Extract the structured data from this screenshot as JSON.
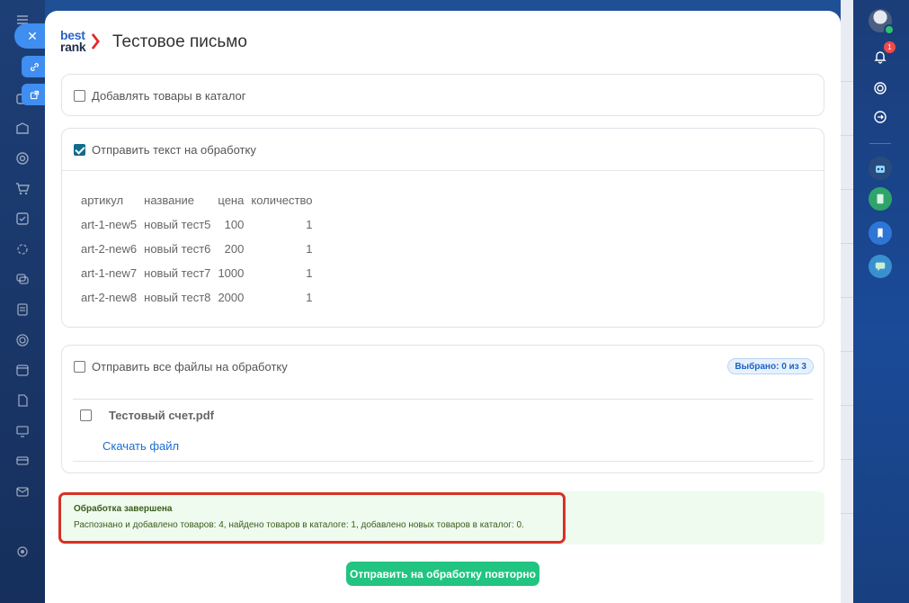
{
  "modal": {
    "logo_top": "best",
    "logo_bottom": "rank",
    "title": "Тестовое письмо"
  },
  "catalog_option": {
    "label": "Добавлять товары в каталог",
    "checked": false
  },
  "text_option": {
    "label": "Отправить текст на обработку",
    "checked": true,
    "table": {
      "headers": [
        "артикул",
        "название",
        "цена",
        "количество"
      ],
      "rows": [
        [
          "art-1-new5",
          "новый тест5",
          "100",
          "1"
        ],
        [
          "art-2-new6",
          "новый тест6",
          "200",
          "1"
        ],
        [
          "art-1-new7",
          "новый тест7",
          "1000",
          "1"
        ],
        [
          "art-2-new8",
          "новый тест8",
          "2000",
          "1"
        ]
      ]
    }
  },
  "files_option": {
    "label": "Отправить все файлы на обработку",
    "checked": false,
    "selected_badge": "Выбрано: 0 из 3",
    "file": {
      "name": "Тестовый счет.pdf",
      "checked": false,
      "download_label": "Скачать файл"
    }
  },
  "result": {
    "title": "Обработка завершена",
    "text": "Распознано и добавлено товаров: 4, найдено товаров в каталоге: 1, добавлено новых товаров в каталог: 0."
  },
  "actions": {
    "resend_label": "Отправить на обработку повторно"
  },
  "right_rail": {
    "notifications_count": "1"
  },
  "colors": {
    "accent_blue": "#3f8ef0",
    "success_green": "#21c480",
    "highlight_red": "#d93025",
    "link_blue": "#1a6dd1"
  }
}
